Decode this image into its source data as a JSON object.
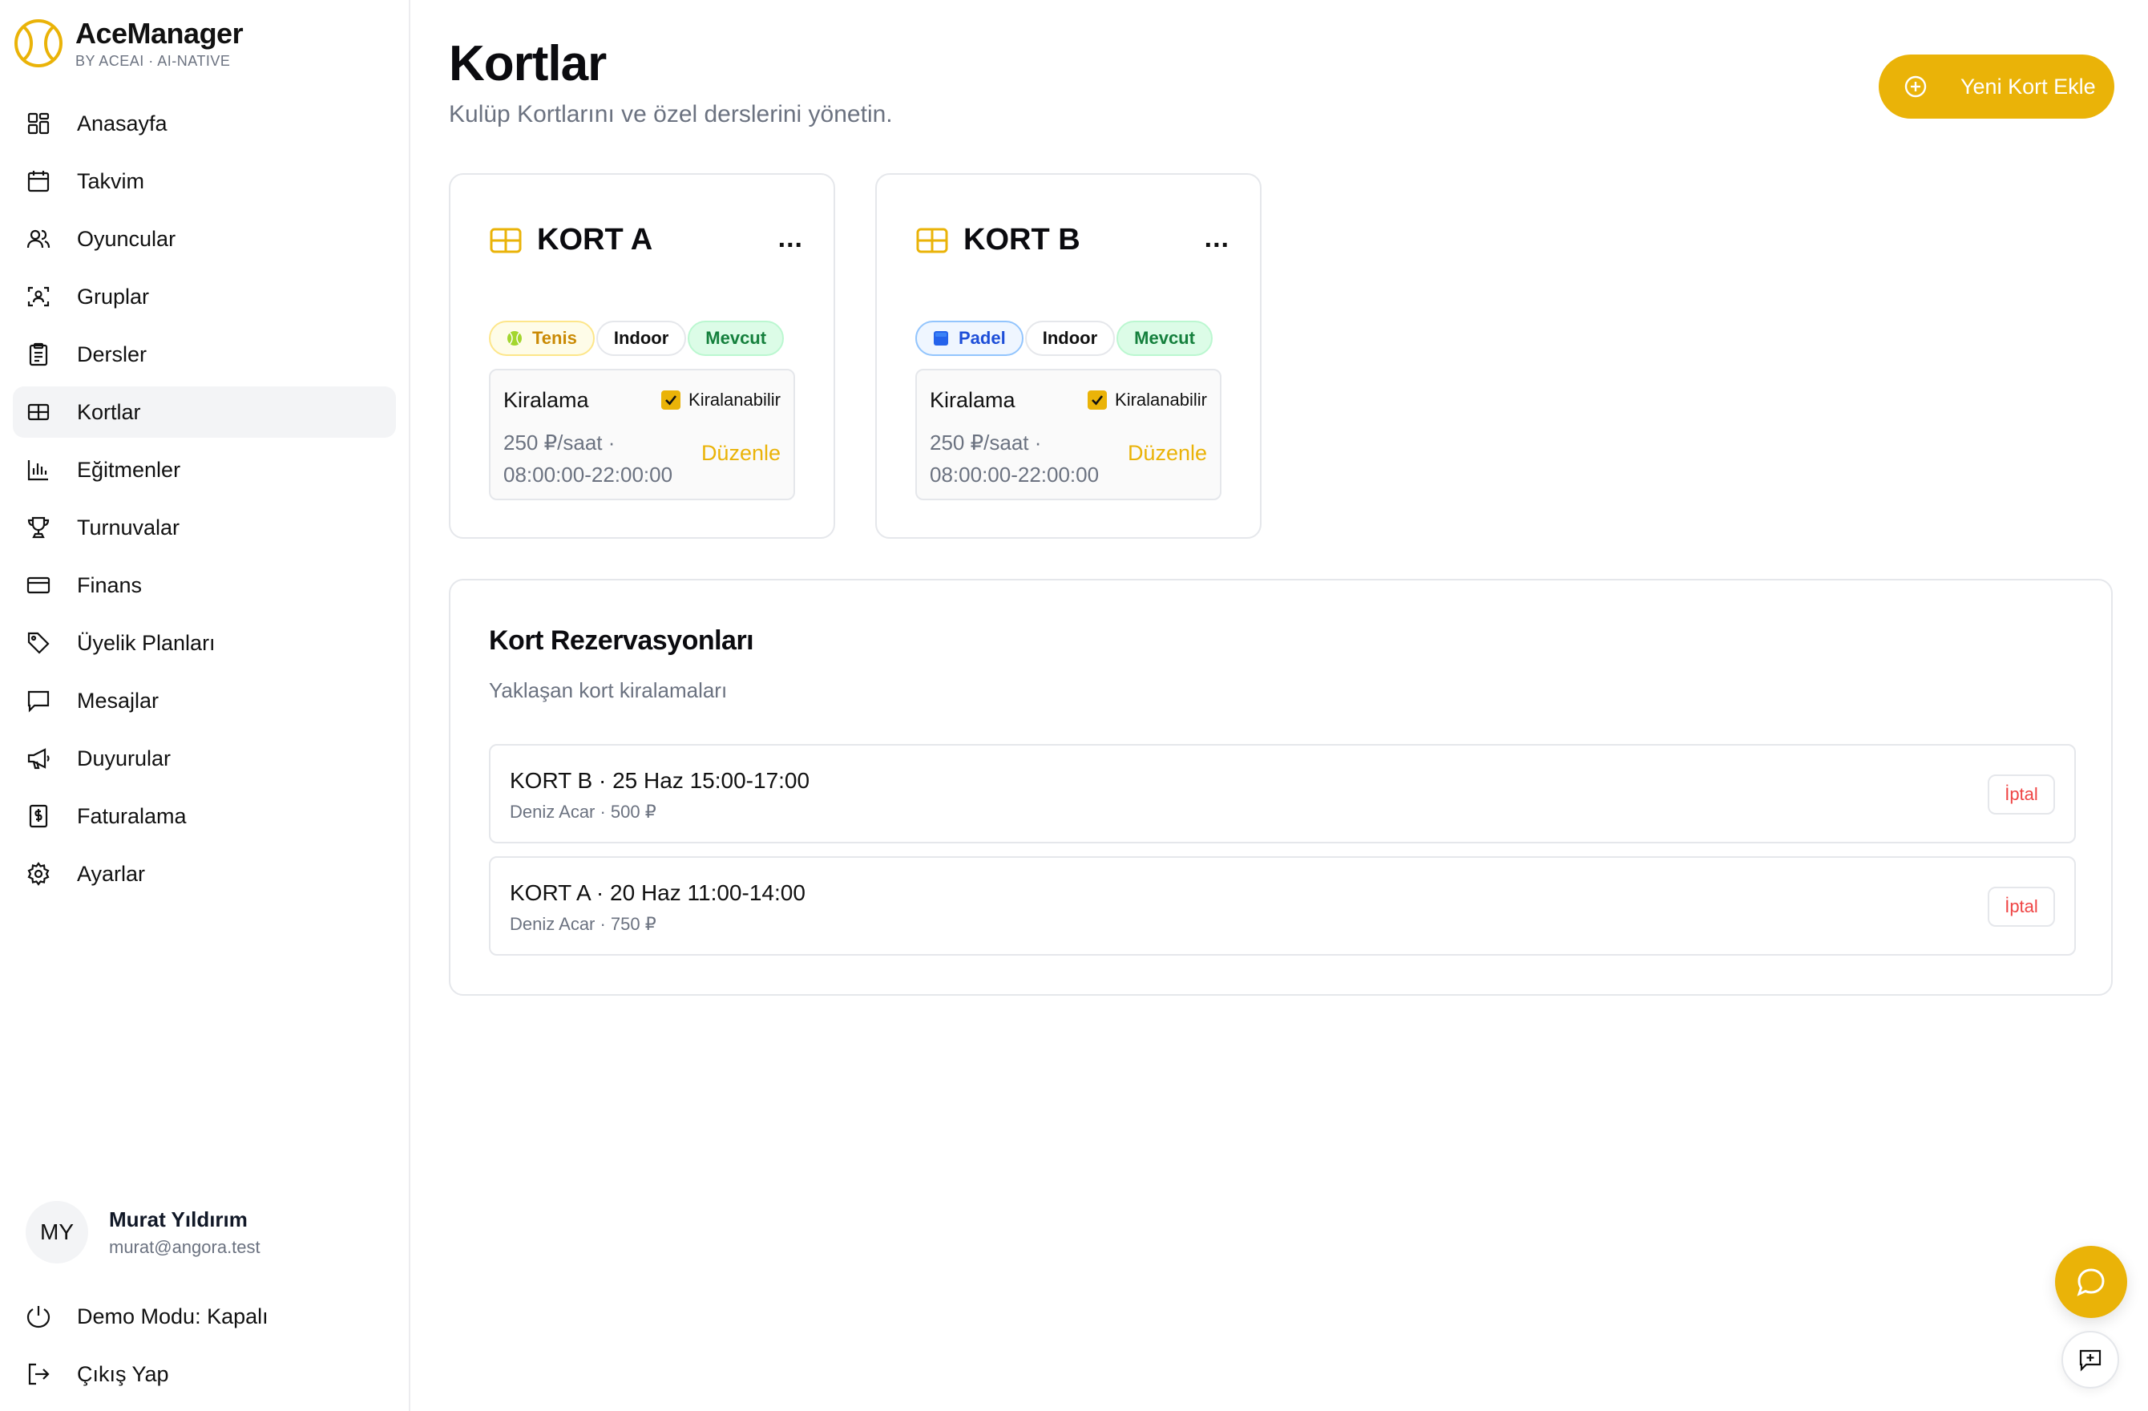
{
  "brand": {
    "name": "AceManager",
    "subtitle": "BY ACEAI · AI-NATIVE",
    "accent": "#eab308"
  },
  "nav": [
    {
      "label": "Anasayfa",
      "icon": "dashboard-icon"
    },
    {
      "label": "Takvim",
      "icon": "calendar-icon"
    },
    {
      "label": "Oyuncular",
      "icon": "users-icon"
    },
    {
      "label": "Gruplar",
      "icon": "groups-icon"
    },
    {
      "label": "Dersler",
      "icon": "clipboard-icon"
    },
    {
      "label": "Kortlar",
      "icon": "court-icon",
      "active": true
    },
    {
      "label": "Eğitmenler",
      "icon": "bar-chart-icon"
    },
    {
      "label": "Turnuvalar",
      "icon": "trophy-icon"
    },
    {
      "label": "Finans",
      "icon": "credit-card-icon"
    },
    {
      "label": "Üyelik Planları",
      "icon": "tag-icon"
    },
    {
      "label": "Mesajlar",
      "icon": "message-icon"
    },
    {
      "label": "Duyurular",
      "icon": "megaphone-icon"
    },
    {
      "label": "Faturalama",
      "icon": "invoice-icon"
    },
    {
      "label": "Ayarlar",
      "icon": "gear-icon"
    }
  ],
  "user": {
    "initials": "MY",
    "name": "Murat Yıldırım",
    "email": "murat@angora.test"
  },
  "footer": {
    "demo_label": "Demo Modu: Kapalı",
    "logout_label": "Çıkış Yap"
  },
  "page": {
    "title": "Kortlar",
    "subtitle": "Kulüp Kortlarını ve özel derslerini yönetin.",
    "add_button": "Yeni Kort Ekle"
  },
  "courts": [
    {
      "name": "KORT A",
      "more": "...",
      "sport": "Tenis",
      "sport_icon": "tennis-ball-icon",
      "type": "Indoor",
      "status": "Mevcut",
      "rent_title": "Kiralama",
      "rentable_label": "Kiralanabilir",
      "rentable": true,
      "price_line1": "250 ₽/saat ·",
      "price_line2": "08:00:00-22:00:00",
      "edit_label": "Düzenle"
    },
    {
      "name": "KORT B",
      "more": "...",
      "sport": "Padel",
      "sport_icon": "blue-square-icon",
      "type": "Indoor",
      "status": "Mevcut",
      "rent_title": "Kiralama",
      "rentable_label": "Kiralanabilir",
      "rentable": true,
      "price_line1": "250 ₽/saat ·",
      "price_line2": "08:00:00-22:00:00",
      "edit_label": "Düzenle"
    }
  ],
  "reservations": {
    "title": "Kort Rezervasyonları",
    "subtitle": "Yaklaşan kort kiralamaları",
    "items": [
      {
        "main": "KORT B · 25 Haz 15:00-17:00",
        "meta": "Deniz Acar · 500 ₽",
        "cancel": "İptal"
      },
      {
        "main": "KORT A · 20 Haz 11:00-14:00",
        "meta": "Deniz Acar · 750 ₽",
        "cancel": "İptal"
      }
    ]
  }
}
